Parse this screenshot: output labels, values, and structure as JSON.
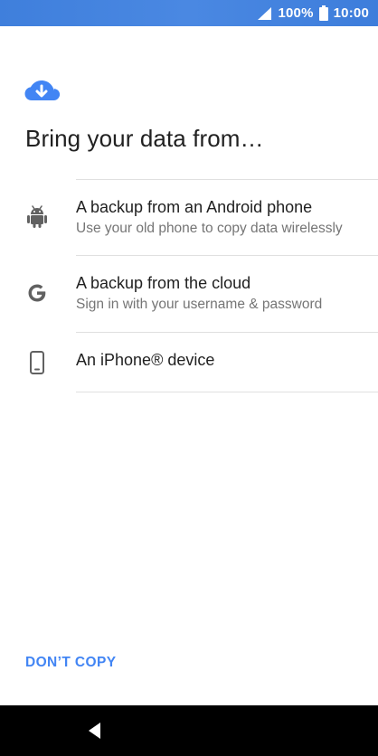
{
  "status_bar": {
    "battery_percent": "100%",
    "time": "10:00",
    "signal_icon": "signal-icon",
    "battery_icon": "battery-icon",
    "background_color": "#4184e0"
  },
  "header": {
    "icon": "cloud-download-icon",
    "icon_color": "#4285f4",
    "title": "Bring your data from…"
  },
  "options": [
    {
      "icon": "android-icon",
      "title": "A backup from an Android phone",
      "subtitle": "Use your old phone to copy data wirelessly"
    },
    {
      "icon": "google-icon",
      "title": "A backup from the cloud",
      "subtitle": "Sign in with your username & password"
    },
    {
      "icon": "phone-icon",
      "title": "An iPhone® device",
      "subtitle": ""
    }
  ],
  "footer": {
    "dont_copy_label": "DON’T COPY",
    "accent_color": "#4285f4"
  },
  "nav_bar": {
    "back_icon": "back-triangle-icon"
  }
}
